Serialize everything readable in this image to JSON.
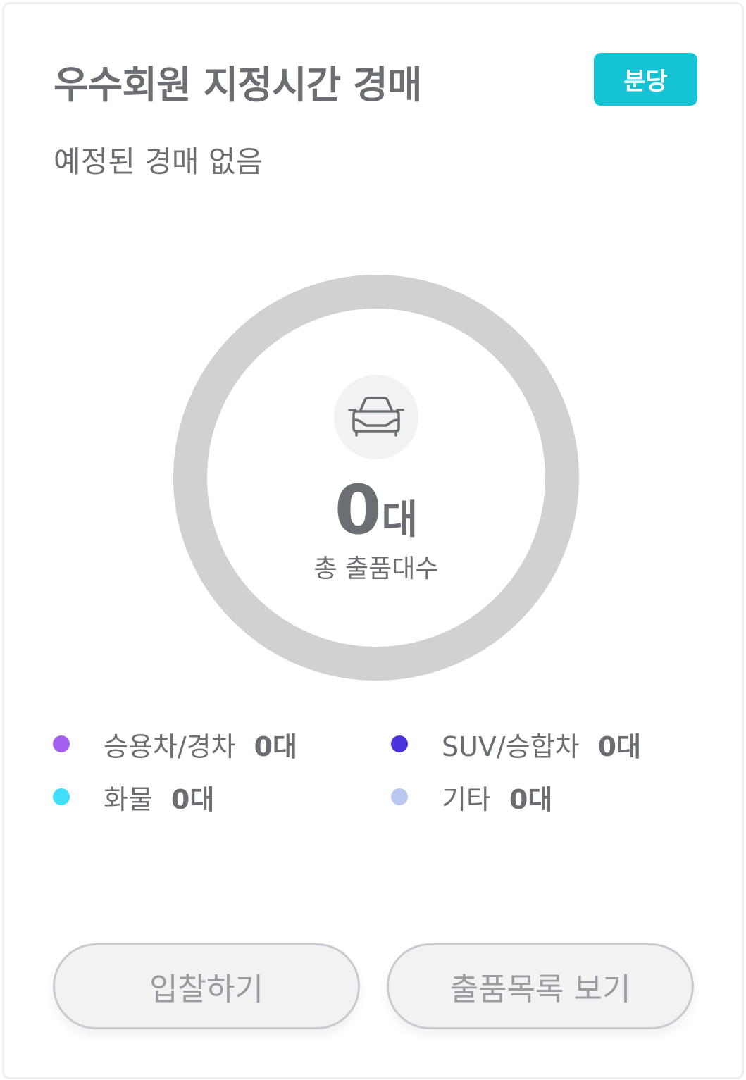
{
  "header": {
    "title": "우수회원 지정시간 경매",
    "badge": "분당",
    "badge_color": "#14c3d4"
  },
  "status": {
    "subtitle": "예정된 경매 없음"
  },
  "summary": {
    "icon": "car-icon",
    "total_count": "0",
    "total_unit": "대",
    "total_label": "총 출품대수",
    "ring_color": "#d1d1d1"
  },
  "legend": [
    {
      "label": "승용차/경차",
      "count": "0대",
      "color": "#a35ff0"
    },
    {
      "label": "SUV/승합차",
      "count": "0대",
      "color": "#4a34e0"
    },
    {
      "label": "화물",
      "count": "0대",
      "color": "#40e0fa"
    },
    {
      "label": "기타",
      "count": "0대",
      "color": "#b9c8ef"
    }
  ],
  "actions": {
    "bid_label": "입찰하기",
    "list_label": "출품목록 보기"
  }
}
